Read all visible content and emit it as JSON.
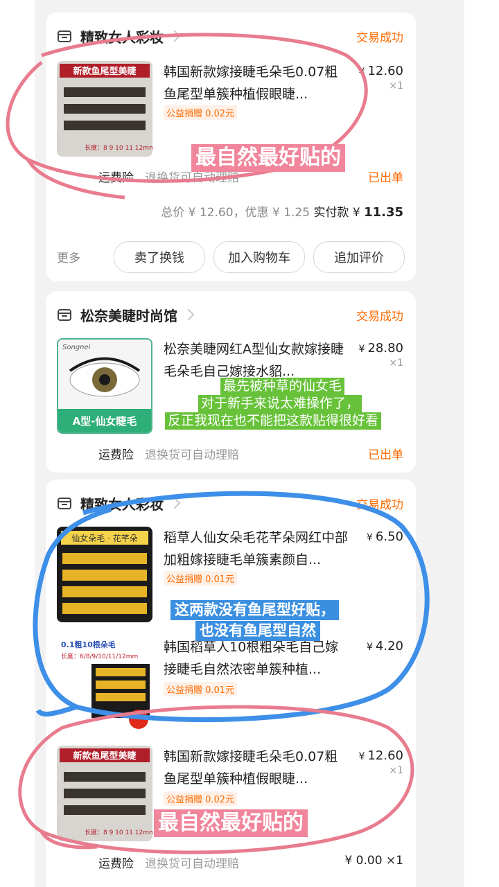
{
  "colors": {
    "accent": "#ff6a00",
    "pink_annotation": "#e87c8e",
    "blue_annotation": "#3e8fe8",
    "green_annotation": "#67c23a"
  },
  "orders": [
    {
      "store": "精致女人彩妆",
      "status": "交易成功",
      "items": [
        {
          "title": "韩国新款嫁接睫毛朵毛0.07粗鱼尾型单簇种植假眼睫...",
          "price": "12.60",
          "qty": "×1",
          "charity": "公益捐赠 0.02元",
          "thumb_label": "新款鱼尾型美睫",
          "thumb_sub": "长度：8 9 10 11 12mm"
        }
      ],
      "insurance": "运费险",
      "insurance_text": "退换货可自动理赔",
      "shipped": "已出单",
      "total": {
        "label": "总价",
        "amount": "12.60",
        "discount_label": "优惠",
        "discount": "1.25",
        "pay_label": "实付款",
        "pay": "11.35"
      },
      "actions": {
        "more": "更多",
        "sell": "卖了换钱",
        "cart": "加入购物车",
        "review": "追加评价"
      }
    },
    {
      "store": "松奈美睫时尚馆",
      "status": "交易成功",
      "items": [
        {
          "title": "松奈美睫网红A型仙女款嫁接睫毛朵毛自己嫁接水貂...",
          "price": "28.80",
          "qty": "×1",
          "thumb_label": "A型-仙女睫毛",
          "thumb_brand": "Songnei"
        }
      ],
      "insurance": "运费险",
      "insurance_text": "退换货可自动理赔",
      "shipped": "已出单"
    },
    {
      "store": "精致女人彩妆",
      "status": "交易成功",
      "items": [
        {
          "title": "稻草人仙女朵毛花芊朵网红中部加粗嫁接睫毛单簇素颜自...",
          "price": "6.50",
          "charity": "公益捐赠 0.01元",
          "thumb_label": "仙女朵毛 · 花芊朵"
        },
        {
          "title": "韩国稻草人10根粗朵毛自己嫁接睫毛自然浓密单簇种植...",
          "price": "4.20",
          "charity": "公益捐赠 0.01元",
          "thumb_label": "0.1粗10根朵毛",
          "thumb_sub": "长度：6/8/9/10/11/12mm"
        },
        {
          "title": "韩国新款嫁接睫毛朵毛0.07粗鱼尾型单簇种植假眼睫...",
          "price": "12.60",
          "qty": "×1",
          "charity": "公益捐赠 0.02元",
          "thumb_label": "新款鱼尾型美睫",
          "thumb_sub": "长度：8 9 10 11 12mm"
        }
      ],
      "insurance": "运费险",
      "insurance_text": "退换货可自动理赔",
      "bottom_price": "¥ 0.00 ×1"
    }
  ],
  "annotations": {
    "pink1": "最自然最好贴的",
    "green": [
      "最先被种草的仙女毛",
      "对于新手来说太难操作了，",
      "反正我现在也不能把这款贴得很好看"
    ],
    "blue": [
      "这两款没有鱼尾型好贴，",
      "也没有鱼尾型自然"
    ],
    "pink2": "最自然最好贴的"
  }
}
